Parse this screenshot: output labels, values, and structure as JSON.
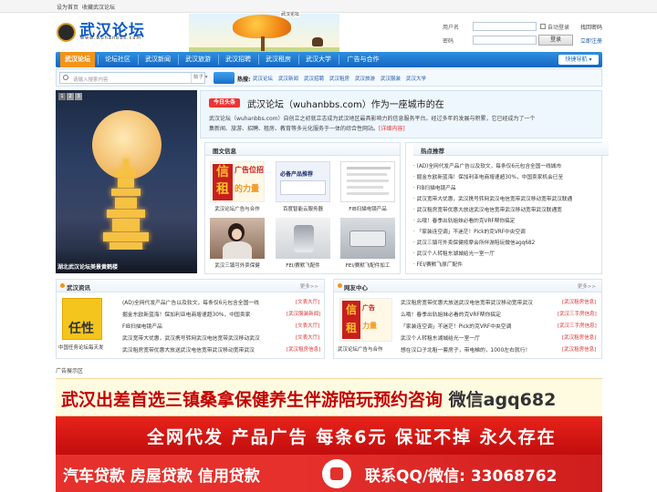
{
  "topbar": {
    "set_home": "设为首页",
    "add_fav": "收藏武汉论坛"
  },
  "header": {
    "logo_text": "武汉论坛",
    "logo_url": "www.wuhanbbs.com",
    "banner_sign": "武汉论坛"
  },
  "login": {
    "username_label": "用户名",
    "password_label": "密码",
    "auto_login": "自动登录",
    "forgot_password": "找回密码",
    "login_button": "登录",
    "register": "立即注册"
  },
  "nav": {
    "items": [
      "武汉论坛",
      "论坛社区",
      "武汉新闻",
      "武汉旅游",
      "武汉招聘",
      "武汉租房",
      "武汉大学",
      "广告与合作"
    ],
    "quick_nav": "快捷导航"
  },
  "search": {
    "placeholder": "请输入搜索内容",
    "type": "帖子",
    "hot_label": "热搜:",
    "hot_links": [
      "武汉论坛",
      "武汉新闻",
      "武汉招聘",
      "武汉租房",
      "武汉旅游",
      "武汉服装",
      "武汉大学"
    ]
  },
  "slideshow": {
    "nums": [
      "1",
      "2",
      "3"
    ],
    "caption": "湖北武汉论坛美景黄鹤楼"
  },
  "headline": {
    "tag": "今日头条",
    "title": "武汉论坛（wuhanbbs.com）作为一座城市的在",
    "body_line1": "武汉论坛（wuhanbbs.com）自创立之初就立志成为武汉地区最具影响力的信息服务平台。经过多年的发展与积累，它已经成为了一个",
    "body_line2": "集新闻、旅游、招聘、租房、教育等多元化服务于一体的综合性网站。",
    "detail": "[详细内容]"
  },
  "photo_panel": {
    "title": "图文信息",
    "items": [
      {
        "caption": "武汉论坛广告与合作"
      },
      {
        "caption": "百度智能云服务器"
      },
      {
        "caption": "FIB扫描电镜产品"
      },
      {
        "caption": "武汉三镇可外卖保健"
      },
      {
        "caption": "FEI/赛默飞配件"
      },
      {
        "caption": "FEI/赛默飞配件加工"
      }
    ],
    "thumb1_text": "广告位招租",
    "thumb2_text": "必备产品推荐"
  },
  "hot_panel": {
    "title": "热点推荐",
    "items": [
      "(AD)全网代发产品广告以及软文，每条仅6元包含全国一线城市",
      "掘金东欧新蓝海！保加利亚电商增速超30%，中国卖家机会已至",
      "FIB扫描电镜产品",
      "武汉宽带大优惠，武汉携号转网武汉电信宽带武汉移动宽带武汉联通",
      "武汉租房宽带优惠大放送武汉电信宽带武汉移动宽带武汉联通宽",
      "么哦！春季出轨姐妹必看的克VRF帮你搞定",
      "「家装连空调」不迷茫！Pick的克VRF中央空调",
      "武汉三镇可外卖保健按摩会所伴游陪玩微信agq682",
      "武汉个人转租东湖城给光一室一厅",
      "FEI/赛默飞原厂配件"
    ]
  },
  "news_panel": {
    "title": "武汉资讯",
    "more": "更多>>",
    "thumb_caption": "中国任务论坛每天发",
    "thumb_text": "任性",
    "rows": [
      {
        "text": "(AD)全网代发产品广告以及软文，每条仅6元包含全国一线",
        "date": "[文表大厅]"
      },
      {
        "text": "掘金东欧新蓝海！保加利亚电商增速超30%，中国卖家",
        "date": "[武汉服装新闻]"
      },
      {
        "text": "FIB扫描电镜产品",
        "date": "[文表大厅]"
      },
      {
        "text": "武汉宽带大优惠，武汉携号转网武汉电信宽带武汉移动武汉",
        "date": "[文表大厅]"
      },
      {
        "text": "武汉租房宽带优惠大放送武汉电信宽带武汉移动宽带武汉",
        "date": "[武汉租房信息]"
      }
    ]
  },
  "friends_panel": {
    "title": "网友中心",
    "more": "更多>>",
    "thumb_caption": "武汉论坛广告与合作",
    "rows": [
      {
        "text": "武汉租房宽带优惠大放送武汉电信宽带武汉移动宽带武汉",
        "date": "[武汉租房信息]"
      },
      {
        "text": "么哦！春季出轨姐妹必看的克VRF帮你搞定",
        "date": "[武汉三手房信息]"
      },
      {
        "text": "「家装连空调」不迷茫！Pick的克VRF中央空调",
        "date": "[武汉三手房信息]"
      },
      {
        "text": "武汉个人转租东湖城给光一室一厅",
        "date": "[武汉租房信息]"
      },
      {
        "text": "想在汉口子北租一套房子，带电梯的，1000左右就行！",
        "date": "[武汉租房信息]"
      }
    ]
  },
  "ads": {
    "area_title": "广告展示区",
    "ad1": "武汉出差首选三镇桑拿保健养生伴游陪玩预约咨询",
    "ad1_wx": "微信agq682",
    "ad2": "全网代发 产品广告 每条6元 保证不掉 永久存在",
    "ad3_left": "汽车贷款 房屋贷款 信用贷款",
    "ad3_right": "联系QQ/微信: 33068762"
  },
  "colors": {
    "nav_blue": "#1466c0",
    "nav_active": "#f39418",
    "ad_red": "#c40000"
  }
}
